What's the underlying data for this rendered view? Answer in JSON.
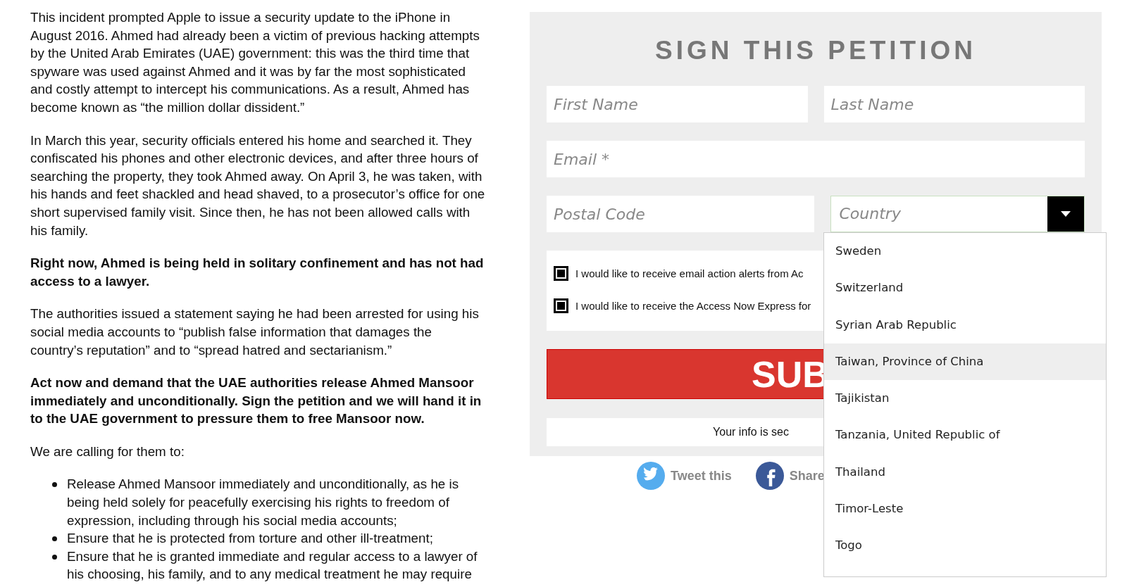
{
  "article": {
    "paragraphs": [
      {
        "kind": "normal",
        "text": "This incident prompted Apple to issue a security update to the iPhone in August 2016. Ahmed had already been a victim of previous hacking attempts by the United Arab Emirates (UAE) government: this was the third time that spyware was used against Ahmed and it was by far the most sophisticated and costly attempt to intercept his communications. As a result, Ahmed has become known as “the million dollar dissident.”"
      },
      {
        "kind": "normal",
        "text": "In March this year, security officials entered his home and searched it. They confiscated his phones and other electronic devices, and after three hours of searching the property, they took Ahmed away. On April 3, he was taken, with his hands and feet shackled and head shaved, to a prosecutor’s office for one short supervised family visit. Since then, he has not been allowed calls with his family."
      },
      {
        "kind": "bold",
        "text": "Right now, Ahmed is being held in solitary confinement and has not had access to a lawyer."
      },
      {
        "kind": "normal",
        "text": "The authorities issued a statement saying he had been arrested for using his social media accounts to “publish false information that damages the country’s reputation” and to “spread hatred and sectarianism.”"
      },
      {
        "kind": "bold",
        "text": "Act now and demand that the UAE authorities release Ahmed Mansoor immediately and unconditionally. Sign the petition and we will hand it in to the UAE government to pressure them to free Mansoor now."
      },
      {
        "kind": "normal",
        "text": "We are calling for them to:"
      }
    ],
    "bullets": [
      "Release Ahmed Mansoor immediately and unconditionally, as he is being held solely for peacefully exercising his rights to freedom of expression, including through his social media accounts;",
      "Ensure that he is protected from torture and other ill-treatment;",
      "Ensure that he is granted immediate and regular access to a lawyer of his choosing, his family, and to any medical treatment he may require"
    ]
  },
  "petition": {
    "title": "SIGN THIS PETITION",
    "fields": {
      "first_name": {
        "placeholder": "First Name"
      },
      "last_name": {
        "placeholder": "Last Name"
      },
      "email": {
        "placeholder": "Email *"
      },
      "postal_code": {
        "placeholder": "Postal Code"
      },
      "country": {
        "placeholder": "Country",
        "expanded": true
      }
    },
    "checkboxes": [
      {
        "label": "I would like to receive email action alerts from Ac",
        "checked": true
      },
      {
        "label": "I would like to receive the Access Now Express for",
        "checked": true
      }
    ],
    "submit": "SUB",
    "info": "Your info is sec",
    "share": [
      {
        "kind": "twitter",
        "label": "Tweet this"
      },
      {
        "kind": "facebook",
        "label": "Share"
      }
    ],
    "country_options": [
      {
        "label": "Sweden",
        "selected": false
      },
      {
        "label": "Switzerland",
        "selected": false
      },
      {
        "label": "Syrian Arab Republic",
        "selected": false
      },
      {
        "label": "Taiwan, Province of China",
        "selected": true
      },
      {
        "label": "Tajikistan",
        "selected": false
      },
      {
        "label": "Tanzania, United Republic of",
        "selected": false
      },
      {
        "label": "Thailand",
        "selected": false
      },
      {
        "label": "Timor-Leste",
        "selected": false
      },
      {
        "label": "Togo",
        "selected": false
      }
    ]
  }
}
